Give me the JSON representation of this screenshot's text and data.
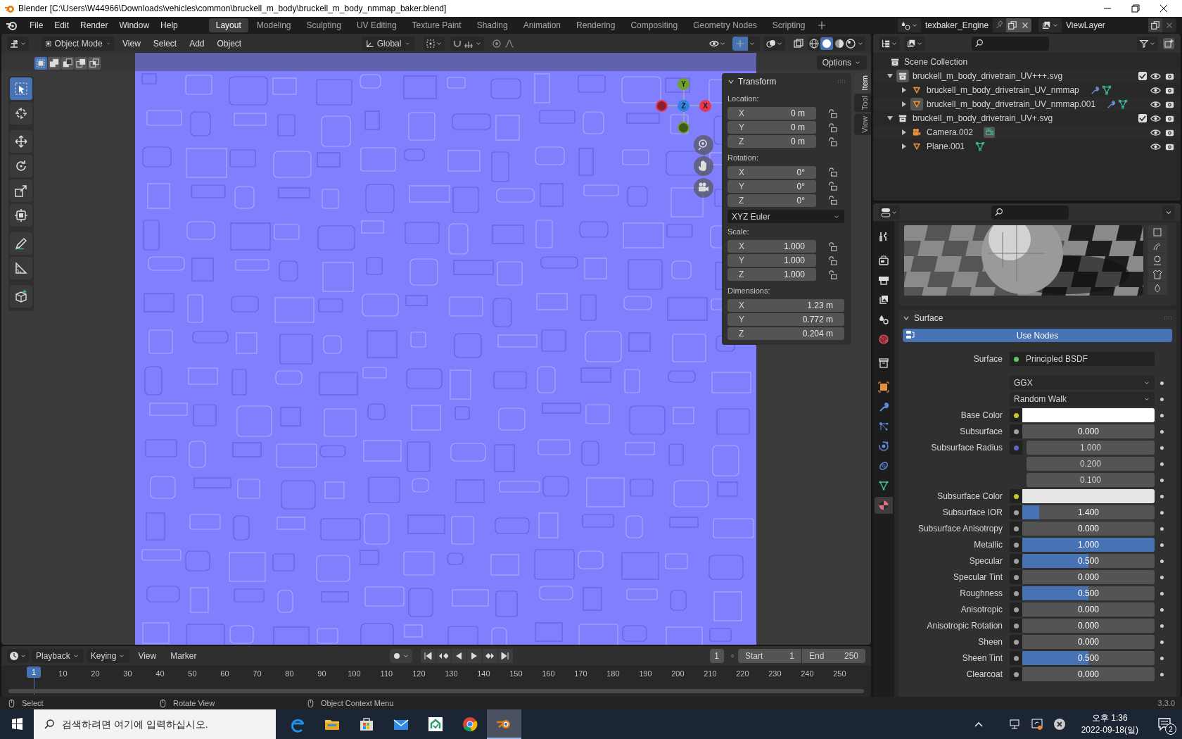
{
  "window": {
    "title": "Blender [C:\\Users\\W44966\\Downloads\\vehicles\\common\\bruckell_m_body\\bruckell_m_body_nmmap_baker.blend]"
  },
  "menu": [
    "File",
    "Edit",
    "Render",
    "Window",
    "Help"
  ],
  "workspaces": [
    {
      "label": "Layout",
      "selected": true
    },
    {
      "label": "Modeling",
      "selected": false
    },
    {
      "label": "Sculpting",
      "selected": false
    },
    {
      "label": "UV Editing",
      "selected": false
    },
    {
      "label": "Texture Paint",
      "selected": false
    },
    {
      "label": "Shading",
      "selected": false
    },
    {
      "label": "Animation",
      "selected": false
    },
    {
      "label": "Rendering",
      "selected": false
    },
    {
      "label": "Compositing",
      "selected": false
    },
    {
      "label": "Geometry Nodes",
      "selected": false
    },
    {
      "label": "Scripting",
      "selected": false
    }
  ],
  "scene": {
    "name": "texbaker_Engine"
  },
  "view_layer": {
    "name": "ViewLayer"
  },
  "viewport": {
    "mode": "Object Mode",
    "snapping": false,
    "menus": [
      "View",
      "Select",
      "Add",
      "Object"
    ],
    "orientation": "Global",
    "options": "Options",
    "selection_modes": [
      {
        "kind": "set",
        "selected": true
      },
      {
        "kind": "extend",
        "selected": false
      },
      {
        "kind": "subtract",
        "selected": false
      },
      {
        "kind": "invert",
        "selected": false
      },
      {
        "kind": "intersect",
        "selected": false
      }
    ],
    "tools": [
      {
        "kind": "select",
        "selected": true
      },
      {
        "kind": "cursor",
        "selected": false
      },
      {
        "kind": "move",
        "selected": false
      },
      {
        "kind": "rotate",
        "selected": false
      },
      {
        "kind": "scale",
        "selected": false
      },
      {
        "kind": "transform",
        "selected": false
      },
      {
        "kind": "annotate",
        "selected": false
      },
      {
        "kind": "measure",
        "selected": false
      },
      {
        "kind": "add-cube",
        "selected": false
      }
    ],
    "gizmo": {
      "y": "Y",
      "z": "Z",
      "x": "X"
    },
    "sidebar_tabs": [
      {
        "label": "Item",
        "selected": true
      },
      {
        "label": "Tool",
        "selected": false
      },
      {
        "label": "View",
        "selected": false
      }
    ],
    "transform": {
      "title": "Transform",
      "groups": [
        {
          "label": "Location:",
          "locks": true,
          "fields": [
            {
              "axis": "X",
              "value": "0 m"
            },
            {
              "axis": "Y",
              "value": "0 m"
            },
            {
              "axis": "Z",
              "value": "0 m"
            }
          ]
        },
        {
          "label": "Rotation:",
          "locks": true,
          "fields": [
            {
              "axis": "X",
              "value": "0°"
            },
            {
              "axis": "Y",
              "value": "0°"
            },
            {
              "axis": "Z",
              "value": "0°"
            }
          ],
          "mode": "XYZ Euler"
        },
        {
          "label": "Scale:",
          "locks": true,
          "fields": [
            {
              "axis": "X",
              "value": "1.000"
            },
            {
              "axis": "Y",
              "value": "1.000"
            },
            {
              "axis": "Z",
              "value": "1.000"
            }
          ]
        },
        {
          "label": "Dimensions:",
          "locks": false,
          "fields": [
            {
              "axis": "X",
              "value": "1.23 m"
            },
            {
              "axis": "Y",
              "value": "0.772 m"
            },
            {
              "axis": "Z",
              "value": "0.204 m"
            }
          ]
        }
      ]
    }
  },
  "timeline": {
    "menus": [
      "Playback",
      "Keying",
      "View",
      "Marker"
    ],
    "auto_keying": false,
    "current_frame": "1",
    "start_label": "Start",
    "start": "1",
    "end_label": "End",
    "end": "250",
    "playhead": "1",
    "ticks": [
      "10",
      "20",
      "30",
      "40",
      "50",
      "60",
      "70",
      "80",
      "90",
      "100",
      "110",
      "120",
      "130",
      "140",
      "150",
      "160",
      "170",
      "180",
      "190",
      "200",
      "210",
      "220",
      "230",
      "240",
      "250"
    ]
  },
  "outliner": {
    "root": "Scene Collection",
    "items": [
      {
        "name": "bruckell_m_body_drivetrain_UV+++.svg",
        "kind": "collection",
        "expanded": true,
        "checked": true,
        "active": true,
        "children": [
          {
            "name": "bruckell_m_body_drivetrain_UV_nmmap",
            "kind": "mesh",
            "expanded": false,
            "active": false,
            "modifiers": true
          },
          {
            "name": "bruckell_m_body_drivetrain_UV_nmmap.001",
            "kind": "mesh",
            "expanded": false,
            "active": true,
            "modifiers": true
          }
        ]
      },
      {
        "name": "bruckell_m_body_drivetrain_UV+.svg",
        "kind": "collection",
        "expanded": true,
        "checked": true,
        "active": false,
        "children": [
          {
            "name": "Camera.002",
            "kind": "camera",
            "expanded": false,
            "active": false,
            "modifiers": false
          },
          {
            "name": "Plane.001",
            "kind": "mesh",
            "expanded": false,
            "active": false,
            "modifiers": false
          }
        ]
      }
    ]
  },
  "properties": {
    "tabs": [
      {
        "kind": "tool",
        "selected": false
      },
      {
        "kind": "render",
        "selected": false
      },
      {
        "kind": "output",
        "selected": false
      },
      {
        "kind": "view-layer",
        "selected": false
      },
      {
        "kind": "scene",
        "selected": false
      },
      {
        "kind": "world",
        "selected": false
      },
      {
        "kind": "collection",
        "selected": false
      },
      {
        "kind": "object",
        "selected": false
      },
      {
        "kind": "modifiers",
        "selected": false
      },
      {
        "kind": "particles",
        "selected": false
      },
      {
        "kind": "physics",
        "selected": false
      },
      {
        "kind": "constraints",
        "selected": false
      },
      {
        "kind": "data",
        "selected": false
      },
      {
        "kind": "material",
        "selected": true
      }
    ],
    "panel": "Surface",
    "use_nodes": "Use Nodes",
    "rows": [
      {
        "kind": "link",
        "label": "Surface",
        "color": "#63c763",
        "value": "Principled BSDF"
      },
      {
        "kind": "dropdown",
        "value": "GGX"
      },
      {
        "kind": "dropdown",
        "value": "Random Walk"
      },
      {
        "kind": "color",
        "label": "Base Color",
        "color": "#c7c729",
        "swatch": {
          "color": "#ffffff"
        }
      },
      {
        "kind": "slider",
        "label": "Subsurface",
        "color": "#a1a1a1",
        "value": "0.000",
        "level": 0
      },
      {
        "kind": "vector",
        "label": "Subsurface Radius",
        "color": "#6363c7",
        "values": [
          "1.000",
          "0.200",
          "0.100"
        ]
      },
      {
        "kind": "color",
        "label": "Subsurface Color",
        "color": "#c7c729",
        "swatch": {
          "color": "#e6e6e6"
        }
      },
      {
        "kind": "slider",
        "label": "Subsurface IOR",
        "color": "#a1a1a1",
        "value": "1.400",
        "level": 0.13
      },
      {
        "kind": "slider",
        "label": "Subsurface Anisotropy",
        "color": "#a1a1a1",
        "value": "0.000",
        "level": 0
      },
      {
        "kind": "slider",
        "label": "Metallic",
        "color": "#a1a1a1",
        "value": "1.000",
        "level": 1
      },
      {
        "kind": "slider",
        "label": "Specular",
        "color": "#a1a1a1",
        "value": "0.500",
        "level": 0.5
      },
      {
        "kind": "slider",
        "label": "Specular Tint",
        "color": "#a1a1a1",
        "value": "0.000",
        "level": 0
      },
      {
        "kind": "slider",
        "label": "Roughness",
        "color": "#a1a1a1",
        "value": "0.500",
        "level": 0.5
      },
      {
        "kind": "slider",
        "label": "Anisotropic",
        "color": "#a1a1a1",
        "value": "0.000",
        "level": 0
      },
      {
        "kind": "slider",
        "label": "Anisotropic Rotation",
        "color": "#a1a1a1",
        "value": "0.000",
        "level": 0
      },
      {
        "kind": "slider",
        "label": "Sheen",
        "color": "#a1a1a1",
        "value": "0.000",
        "level": 0
      },
      {
        "kind": "slider",
        "label": "Sheen Tint",
        "color": "#a1a1a1",
        "value": "0.500",
        "level": 0.5
      },
      {
        "kind": "slider",
        "label": "Clearcoat",
        "color": "#a1a1a1",
        "value": "0.000",
        "level": 0
      }
    ]
  },
  "status_bar": {
    "items": [
      "Select",
      "Rotate View",
      "Object Context Menu"
    ],
    "version": "3.3.0"
  },
  "taskbar": {
    "search_placeholder": "검색하려면 여기에 입력하십시오.",
    "apps": [
      {
        "kind": "edge",
        "selected": false
      },
      {
        "kind": "folder",
        "selected": false
      },
      {
        "kind": "store",
        "selected": false
      },
      {
        "kind": "mail",
        "selected": false
      },
      {
        "kind": "app",
        "selected": false
      },
      {
        "kind": "browser",
        "selected": false
      },
      {
        "kind": "blender",
        "selected": true
      }
    ],
    "time": "오후 1:36",
    "date": "2022-09-18(일)",
    "notifications": "2"
  }
}
